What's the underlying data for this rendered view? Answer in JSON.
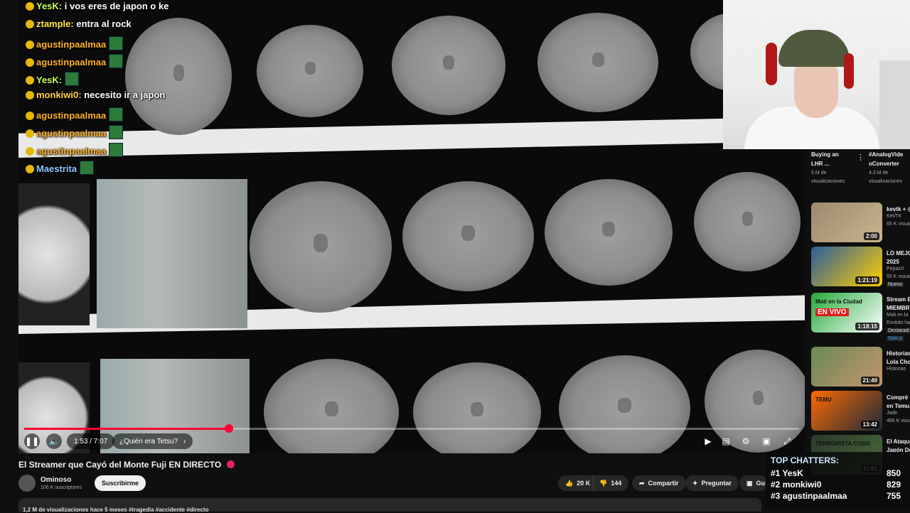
{
  "chat": [
    {
      "user": "YesK:",
      "text": "i vos eres de japon o ke",
      "color": "#c8ff5a"
    },
    {
      "user": "ztample:",
      "text": "entra al rock",
      "color": "#ffe94a"
    },
    {
      "user": "agustinpaalmaa",
      "text": "",
      "color": "#ffb12b"
    },
    {
      "user": "agustinpaalmaa",
      "text": "",
      "color": "#ffb12b"
    },
    {
      "user": "YesK:",
      "text": "",
      "color": "#c8ff5a"
    },
    {
      "user": "monkiwi0:",
      "text": "necesito ir a japon",
      "color": "#ffd54a"
    },
    {
      "user": "agustinpaalmaa",
      "text": "",
      "color": "#ffb12b"
    },
    {
      "user": "agustinpaalmaa",
      "text": "",
      "color": "#ffb12b"
    },
    {
      "user": "agustinpaalmaa",
      "text": "",
      "color": "#ffb12b"
    },
    {
      "user": "Maestrita",
      "text": "",
      "color": "#8ec7ff"
    }
  ],
  "player": {
    "time": "1:53 / 7:07",
    "chapter": "¿Quién era Tetsu?",
    "progress": 0.264
  },
  "video": {
    "title": "El Streamer que Cayó del Monte Fuji EN DIRECTO",
    "channel": "Ominoso",
    "subscribers": "106 K suscriptores",
    "subscribe_label": "Suscribirme",
    "likes": "20 K",
    "dislikes": "144",
    "share": "Compartir",
    "ask": "Preguntar",
    "save": "Gu",
    "info": "1,2 M de visualizaciones  hace 5 meses  #tragedia #accidente #directo"
  },
  "sidebar_top": [
    {
      "title1": "Buying an",
      "title2": "LHR ...",
      "meta1": "5 M de",
      "meta2": "visualizaciones"
    },
    {
      "title1": "#AnalogVide",
      "title2": "oConverter",
      "meta1": "4,3 M de",
      "meta2": "visualizaciones"
    }
  ],
  "recommendations": [
    {
      "title1": "kevtk + @",
      "title2": "",
      "channel": "KevTK",
      "meta": "65 K visual",
      "duration": "2:00",
      "colors": [
        "#9c8a6e",
        "#c9b48e"
      ]
    },
    {
      "title1": "LO MEJO",
      "title2": "2025",
      "channel": "PepazX",
      "meta": "55 K visua",
      "duration": "1:21:19",
      "badge": "Nuevo",
      "colors": [
        "#2a5d9c",
        "#ffd000"
      ]
    },
    {
      "title1": "Stream E",
      "title2": "MIEMBR",
      "channel": "Mati en la",
      "meta": "Emitido ha",
      "duration": "1:18:15",
      "badge": "Destacad",
      "extra": "Solo p",
      "overlay1": "Mati en la Ciudad",
      "overlay2": "EN VIVO",
      "colors": [
        "#22aa3a",
        "#ffffff"
      ]
    },
    {
      "title1": "Historias",
      "title2": "Lola Cho",
      "channel": "Historias",
      "meta": "",
      "duration": "21:49",
      "colors": [
        "#6a8a55",
        "#c4946e"
      ]
    },
    {
      "title1": "Compré",
      "title2": "en Temu",
      "channel": "Jade",
      "meta": "466 K visua",
      "duration": "13:42",
      "overlay1": "TEMU",
      "colors": [
        "#ff6a00",
        "#1c2a3a"
      ]
    },
    {
      "title1": "El Ataque",
      "title2": "Japón De",
      "channel": "",
      "meta": "",
      "duration": "11:01",
      "overlay1": "TERRORISTA CUSO",
      "colors": [
        "#2a3a2a",
        "#4a6a3a"
      ]
    }
  ],
  "top_chatters": {
    "heading": "TOP CHATTERS:",
    "rows": [
      {
        "rank": "#1",
        "name": "YesK",
        "count": "850"
      },
      {
        "rank": "#2",
        "name": "monkiwi0",
        "count": "829"
      },
      {
        "rank": "#3",
        "name": "agustinpaalmaa",
        "count": "755"
      }
    ]
  },
  "icons": [
    "pause-icon",
    "volume-icon",
    "chevron-right-icon",
    "play-next-icon",
    "subtitles-icon",
    "settings-icon",
    "miniplayer-icon",
    "fullscreen-icon",
    "like-icon",
    "dislike-icon",
    "share-icon",
    "sparkle-icon",
    "bookmark-icon",
    "more-vert-icon"
  ]
}
